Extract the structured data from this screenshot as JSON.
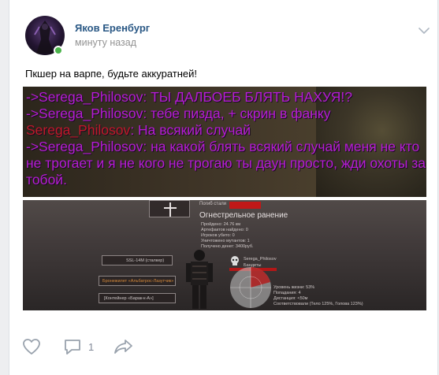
{
  "post": {
    "author": "Яков Еренбург",
    "time": "минуту назад",
    "text": "Пкшер на варпе, будьте аккуратней!"
  },
  "chat_lines": [
    {
      "text": "->Serega_Philosov: ТЫ ДАЛБОЕБ БЛЯТЬ НАХУЯ!?",
      "color": "#b51cd4"
    },
    {
      "text": "->Serega_Philosov: тебе пизда, + скрин в фанку",
      "color": "#b51cd4"
    },
    {
      "name": "Serega_Philosov",
      "text": ": На всякий случай",
      "color": "#c0182a"
    },
    {
      "text": "->Serega_Philosov: на какой блять всякий случай меня не кто",
      "color": "#b51cd4"
    },
    {
      "text": "не трогает и я не кого не трогаю ты даун просто, жди охоты за",
      "color": "#b51cd4"
    },
    {
      "text": "тобой.",
      "color": "#b51cd4"
    }
  ],
  "hud": {
    "killed_by": "Погиб стали",
    "title": "Огнестрельное ранение",
    "stats": [
      "Пройдено: 24.76 км",
      "Артефактов найдено: 0",
      "Игроков убито: 0",
      "Уничтожено мутантов: 1",
      "Получено денег: 3400руб."
    ],
    "weapons": [
      "SSL-14M (сталкер)",
      "Бронежилет «Альбатрос-Лазутчик»",
      "[Контейнер «Барак-к-А»]"
    ],
    "player": "Serega_Philosov",
    "faction": "Бандиты",
    "details": [
      "Уровень жизни: 53%",
      "Попадания: 4",
      "Дистанция: <50м",
      "Соответствовали (Тело 125%, Голова 123%)"
    ]
  },
  "actions": {
    "comments_count": "1"
  },
  "colors": {
    "link": "#2a5885",
    "muted": "#939393",
    "online": "#4bb34b",
    "action_icon": "#99a2ad"
  }
}
